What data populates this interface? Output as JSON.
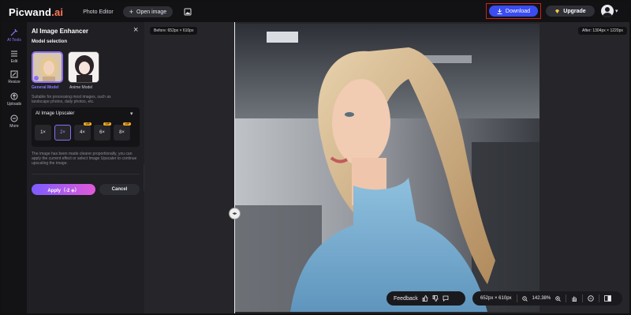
{
  "app": {
    "logo_main": "Picwand",
    "logo_ai": ".ai"
  },
  "topbar": {
    "photo_editor": "Photo Editor",
    "open_image": "Open image",
    "download": "Download",
    "upgrade": "Upgrade"
  },
  "rail": [
    {
      "label": "AI Tools",
      "icon": "ai-tools-icon"
    },
    {
      "label": "Edit",
      "icon": "sliders-icon"
    },
    {
      "label": "Resize",
      "icon": "resize-icon"
    },
    {
      "label": "Uploads",
      "icon": "upload-icon"
    },
    {
      "label": "More",
      "icon": "more-icon"
    }
  ],
  "panel": {
    "title": "AI Image Enhancer",
    "model_selection": "Model selection",
    "models": [
      {
        "label": "General Model"
      },
      {
        "label": "Anime Model"
      }
    ],
    "model_desc": "Suitable for processing most images, such as landscape photos, daily photos, etc.",
    "upscaler_title": "AI Image Upscaler",
    "scales": [
      "1×",
      "2×",
      "4×",
      "6×",
      "8×"
    ],
    "vip_badge": "VIP",
    "upscaler_desc": "The image has been made clearer proportionally, you can apply the current effect or select Image Upscaler to continue upscaling the image.",
    "apply": "Apply（-2 ◈）",
    "cancel": "Cancel"
  },
  "canvas": {
    "before": "Before: 652px × 610px",
    "after": "After: 1304px × 1220px"
  },
  "bottom": {
    "feedback": "Feedback",
    "dimensions": "652px × 610px",
    "zoom": "142.38%"
  },
  "colors": {
    "accent": "#8b6ff5",
    "download": "#3b4cf0",
    "highlight_border": "#d02020"
  }
}
